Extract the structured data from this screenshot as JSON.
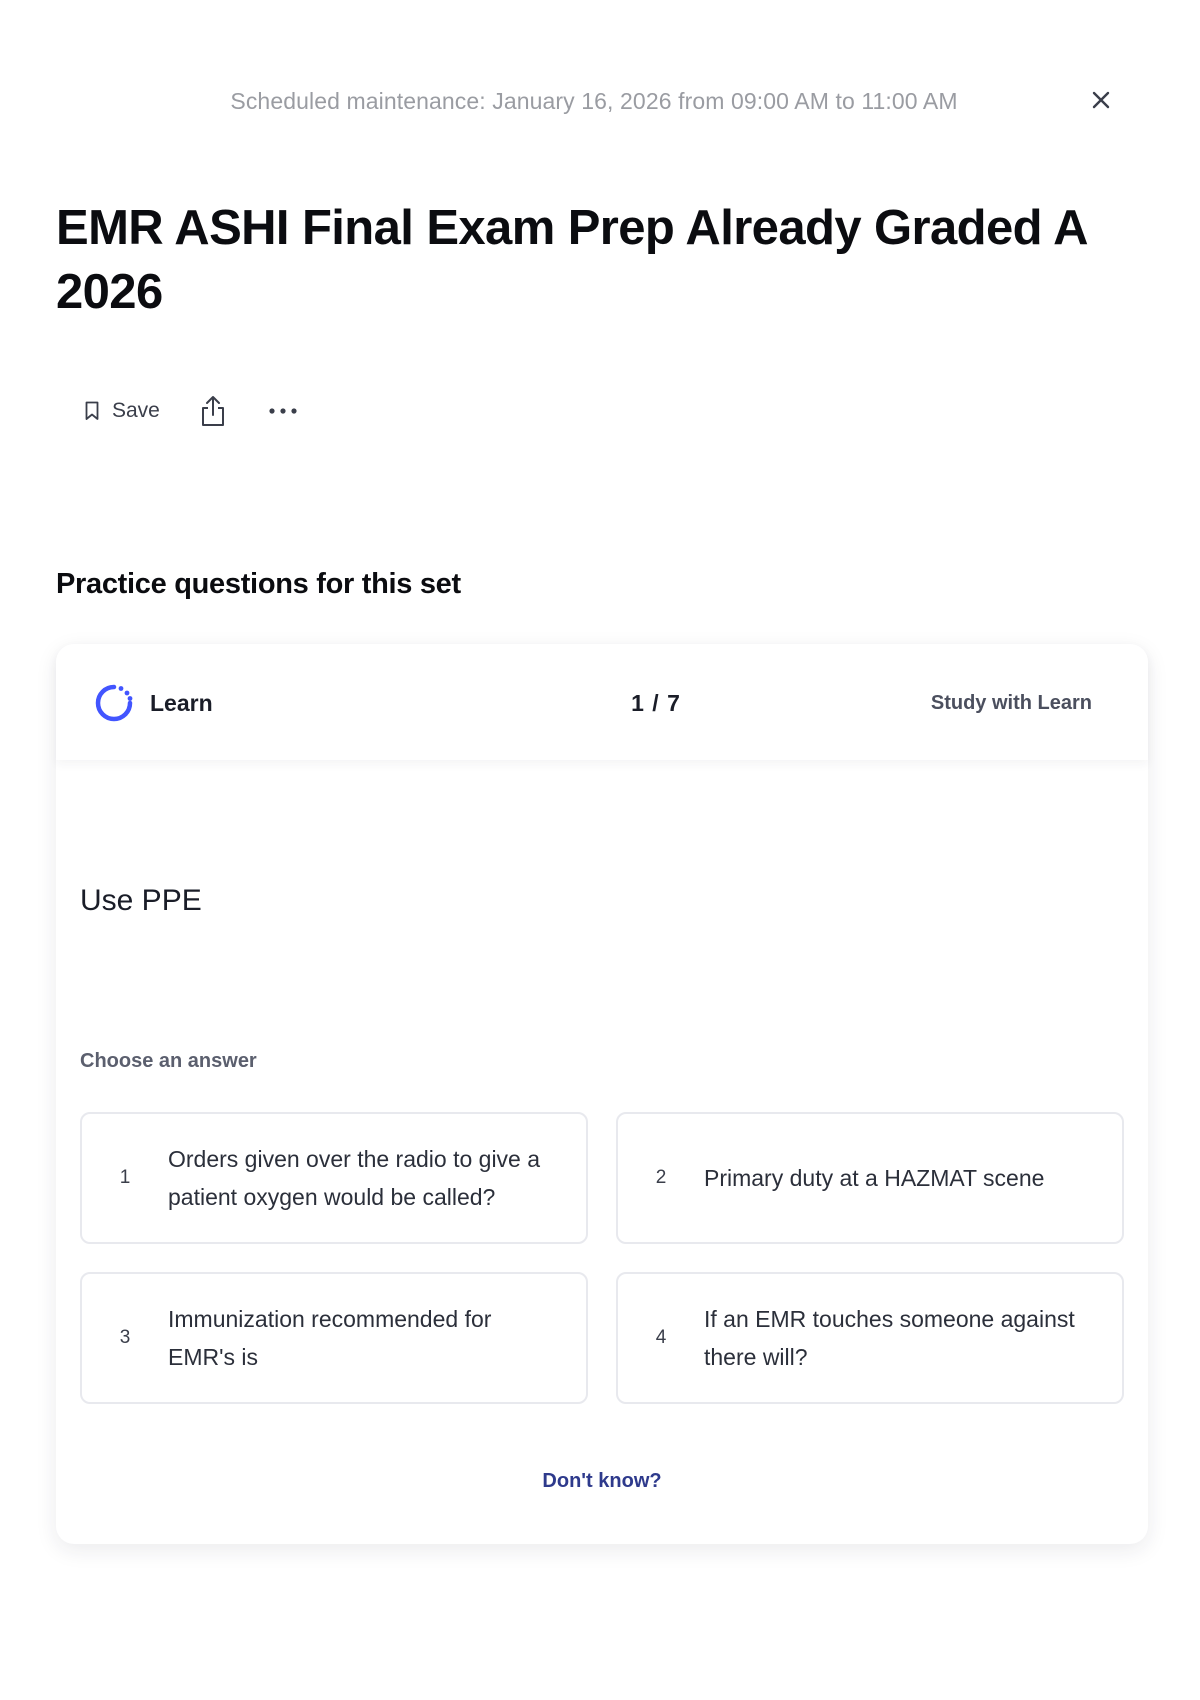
{
  "banner": {
    "text": "Scheduled maintenance: January 16, 2026 from 09:00 AM to 11:00 AM",
    "close_icon": "close-icon"
  },
  "set": {
    "title": "EMR ASHI Final Exam Prep Already Graded A 2026"
  },
  "actions": {
    "save_label": "Save",
    "save_icon": "bookmark-icon",
    "share_icon": "share-icon",
    "more_icon": "more-icon"
  },
  "practice": {
    "section_title": "Practice questions for this set",
    "mode_label": "Learn",
    "mode_icon": "learn-icon",
    "progress": "1 / 7",
    "study_link": "Study with Learn",
    "prompt": "Use PPE",
    "choose_label": "Choose an answer",
    "answers": [
      {
        "num": "1",
        "text": "Orders given over the radio to give a patient oxygen would be called?"
      },
      {
        "num": "2",
        "text": "Primary duty at a HAZMAT scene"
      },
      {
        "num": "3",
        "text": "Immunization recommended for EMR's is"
      },
      {
        "num": "4",
        "text": "If an EMR touches someone against there will?"
      }
    ],
    "dont_know": "Don't know?"
  },
  "colors": {
    "accent": "#4255ff",
    "link": "#2e3a8c",
    "muted_text": "#9a9ca2"
  }
}
